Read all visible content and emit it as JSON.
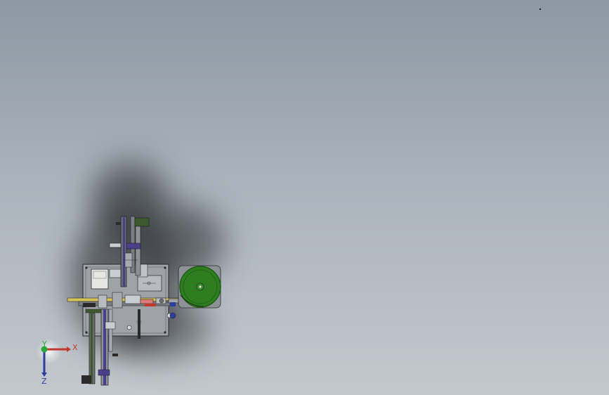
{
  "viewport": {
    "background_top": "#8d98a4",
    "background_bottom": "#c3c8ce"
  },
  "model": {
    "plate_color": "#9fa3a8",
    "frame_color": "#2a2a2a",
    "rail_color": "#3d5a2e",
    "belt_color": "#4b3f8a",
    "feeder_color": "#2e7d1e",
    "feeder_rim": "#1f5c14",
    "accent_red": "#c0392b",
    "accent_blue": "#2c3e9e",
    "accent_yellow": "#d4c35a"
  },
  "triad": {
    "x_label": "X",
    "y_label": "Y",
    "z_label": "Z",
    "x_color": "#c0392b",
    "y_color": "#27a83a",
    "z_color": "#2c3e9e"
  }
}
